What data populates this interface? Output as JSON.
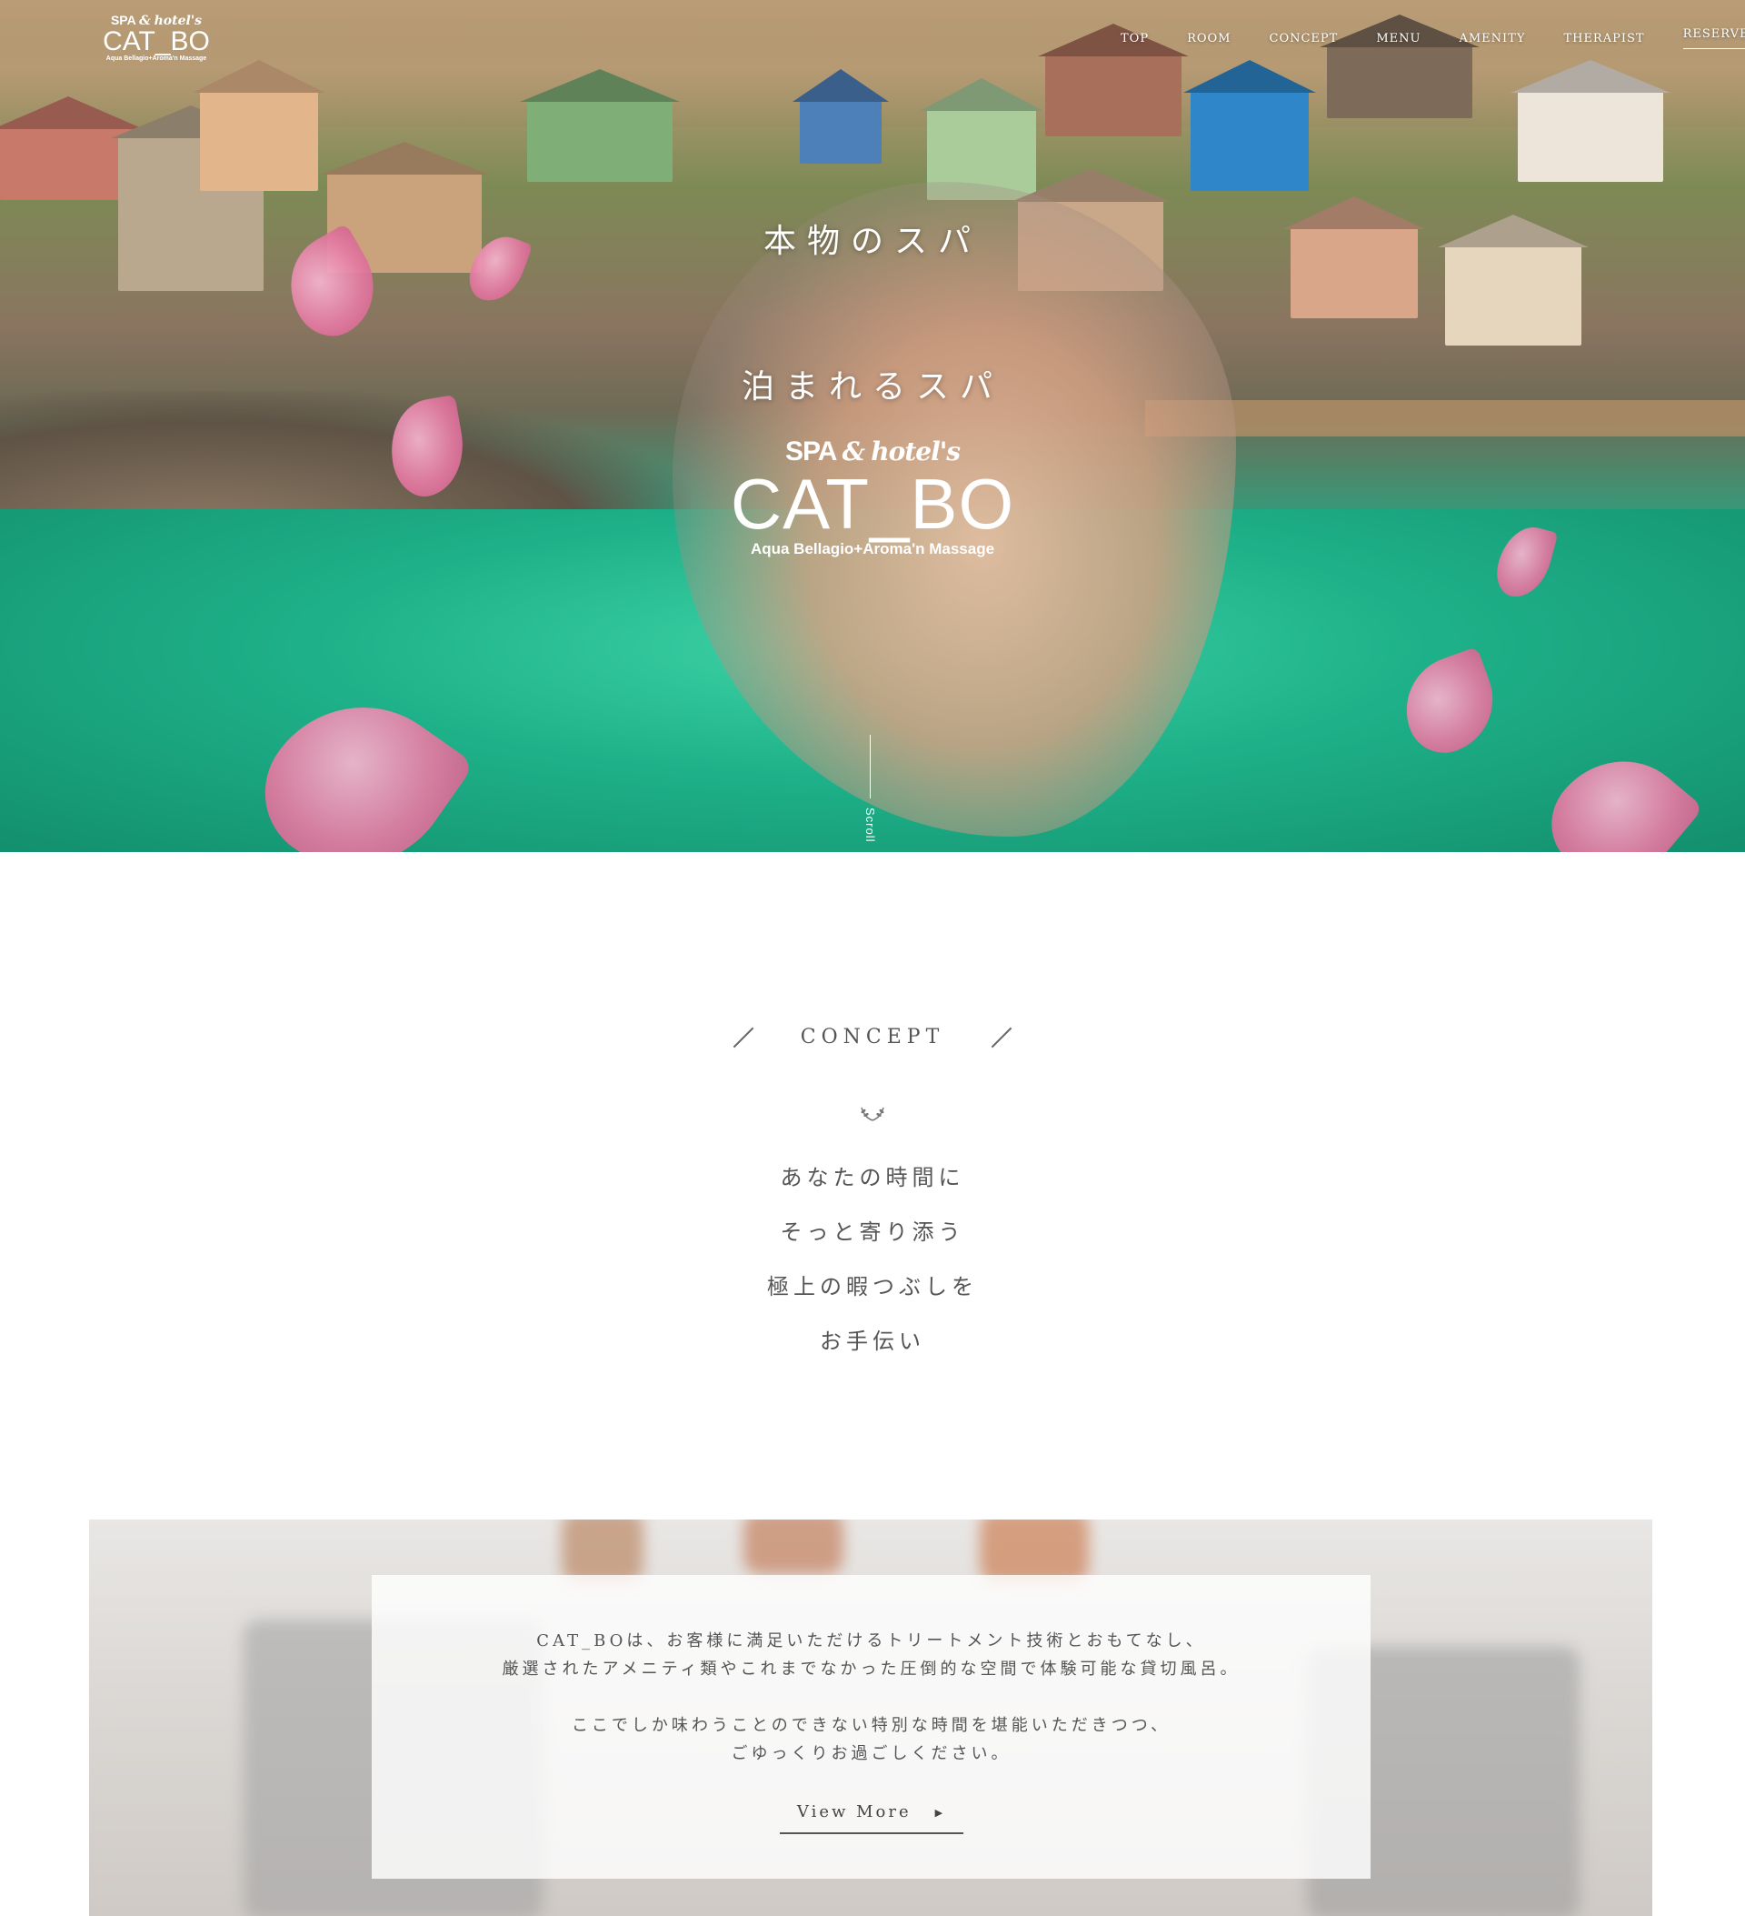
{
  "brand": {
    "spa_line": "SPA",
    "amp": "&",
    "hotels": "hotel's",
    "name": "CAT_BO",
    "subtitle": "Aqua Bellagio+Aroma'n Massage"
  },
  "nav": {
    "items": [
      "TOP",
      "ROOM",
      "CONCEPT",
      "MENU",
      "AMENITY",
      "THERAPIST"
    ],
    "reserve": "RESERVE"
  },
  "hero": {
    "line1": "本物のスパ",
    "line2": "泊まれるスパ",
    "scroll": "Scroll"
  },
  "concept": {
    "heading": "CONCEPT",
    "lines": [
      "あなたの時間に",
      "そっと寄り添う",
      "極上の暇つぶしを",
      "お手伝い"
    ]
  },
  "intro": {
    "paragraph1_line1": "CAT_BOは、お客様に満足いただけるトリートメント技術とおもてなし、",
    "paragraph1_line2": "厳選されたアメニティ類やこれまでなかった圧倒的な空間で体験可能な貸切風呂。",
    "paragraph2_line1": "ここでしか味わうことのできない特別な時間を堪能いただきつつ、",
    "paragraph2_line2": "ごゆっくりお過ごしください。",
    "button": "View More"
  },
  "colors": {
    "water": "#1eb189",
    "petal": "#e47aa2",
    "text": "#555555"
  }
}
